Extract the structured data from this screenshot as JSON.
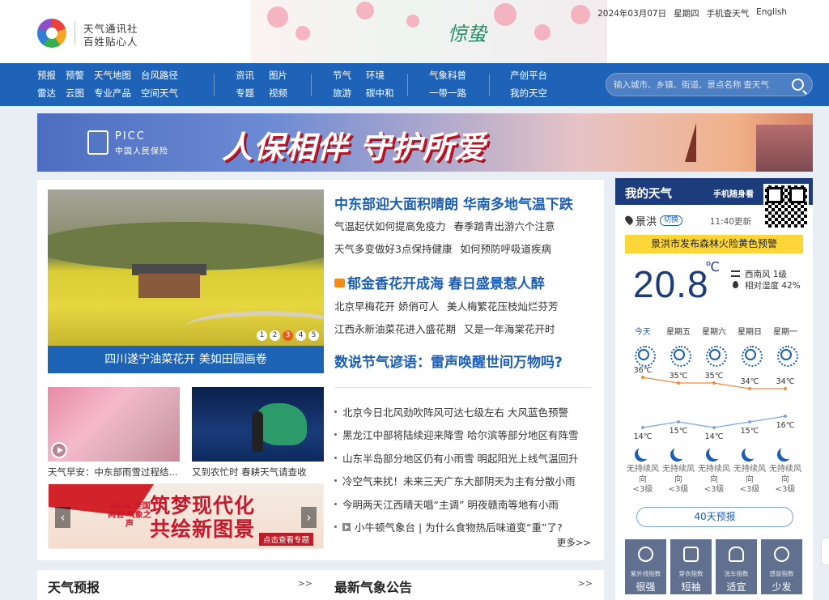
{
  "header": {
    "logo_line1": "天气通讯社",
    "logo_line2": "百姓贴心人",
    "solar_term": "惊蛰",
    "date": "2024年03月07日",
    "weekday": "星期四",
    "mobile_weather": "手机查天气",
    "english": "English"
  },
  "nav": {
    "col1": [
      "预报",
      "预警",
      "天气地图",
      "台风路径",
      "雷达",
      "云图",
      "专业产品",
      "空间天气"
    ],
    "col2": [
      "资讯",
      "图片",
      "专题",
      "视频"
    ],
    "col3": [
      "节气",
      "环境",
      "旅游",
      "碳中和"
    ],
    "col4": [
      "气象科普",
      "一带一路"
    ],
    "col5": [
      "产创平台",
      "我的天空"
    ]
  },
  "search": {
    "placeholder": "输入城市、乡镇、街道、景点名称 查天气"
  },
  "banner": {
    "brand_en": "PICC",
    "brand_cn": "中国人民保险",
    "slogan": "人保相伴 守护所爱"
  },
  "main": {
    "hero_caption": "四川遂宁油菜花开 美如田园画卷",
    "hero_dots": [
      "1",
      "2",
      "3",
      "4",
      "5"
    ],
    "headline1": "中东部迎大面积晴朗 华南多地气温下跌",
    "sub1a": "气温起伏如何提高免疫力",
    "sub1b": "春季踏青出游六个注意",
    "sub2a": "天气多变做好3点保持健康",
    "sub2b": "如何预防呼吸道疾病",
    "headline2": "郁金香花开成海 春日盛景惹人醉",
    "sub3a": "北京早梅花开 娇俏可人",
    "sub3b": "美人梅繁花压枝灿烂芬芳",
    "sub4a": "江西永新油菜花进入盛花期",
    "sub4b": "又是一年海棠花开时",
    "headline3": "数说节气谚语：雷声唤醒世间万物吗?",
    "thumb1_caption": "天气早安：中东部雨雪过程结...",
    "thumb2_caption": "又到农忙时 春耕天气请查收",
    "promo_tag": "2024 全国两会 气象之声",
    "promo_title1": "筑梦现代化",
    "promo_title2": "共绘新图景",
    "promo_more": "点击查看专题",
    "news": [
      "北京今日北风劲吹阵风可达七级左右 大风蓝色预警",
      "黑龙江中部将陆续迎来降雪 哈尔滨等部分地区有阵雪",
      "山东半岛部分地区仍有小雨雪 明起阳光上线气温回升",
      "冷空气来扰！未来三天广东大部阴天为主有分散小雨",
      "今明两天江西晴天唱“主调” 明夜赣南等地有小雨",
      "小牛顿气象台 | 为什么食物热后味道变“重”了?"
    ],
    "more": "更多>>"
  },
  "sections": {
    "forecast": "天气预报",
    "announce": "最新气象公告",
    "more": ">>"
  },
  "weather": {
    "title": "我的天气",
    "mobile": "手机随身看",
    "city": "景洪",
    "switch": "切换",
    "updated": "11:40更新",
    "alert": "景洪市发布森林火险黄色预警",
    "temp": "20.8",
    "unit": "℃",
    "wind": "西南风 1级",
    "humidity": "相对湿度 42%",
    "days": [
      "今天",
      "星期五",
      "星期六",
      "星期日",
      "星期一"
    ],
    "highs": [
      "36℃",
      "35℃",
      "35℃",
      "34℃",
      "34℃"
    ],
    "lows": [
      "14℃",
      "15℃",
      "14℃",
      "15℃",
      "16℃"
    ],
    "wind_desc": [
      "无持续风向",
      "无持续风向",
      "无持续风向",
      "无持续风向",
      "无持续风向"
    ],
    "wind_level": [
      "<3级",
      "<3级",
      "<3级",
      "<3级",
      "<3级"
    ],
    "forty_days": "40天预报",
    "indices": [
      {
        "name": "紫外线指数",
        "value": "很强"
      },
      {
        "name": "穿衣指数",
        "value": "短袖"
      },
      {
        "name": "洗车指数",
        "value": "适宜"
      },
      {
        "name": "感冒指数",
        "value": "少发"
      }
    ]
  },
  "colors": {
    "nav": "#1e63b8",
    "accent": "#1d5eb4",
    "alert": "#fdd73a",
    "panel_head": "#1d3c7c",
    "high_line": "#f08a3a",
    "low_line": "#7aa7e0"
  }
}
